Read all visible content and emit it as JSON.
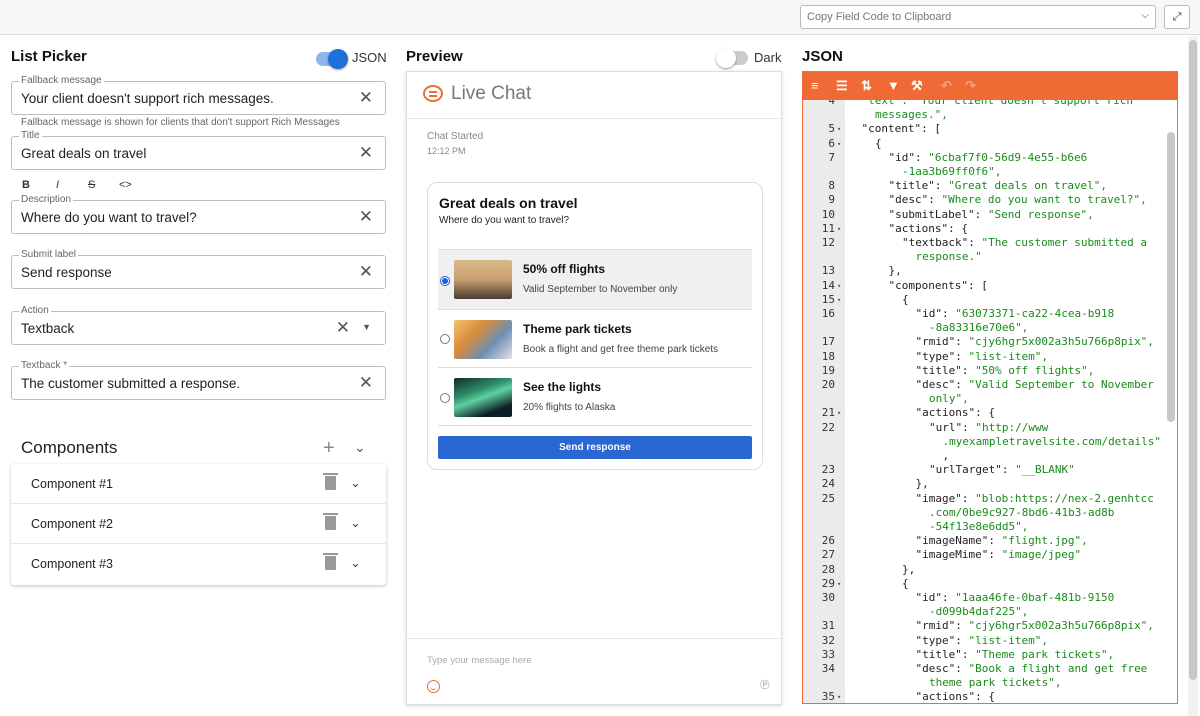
{
  "topbar": {
    "copy_select": "Copy Field Code to Clipboard",
    "expand_icon": "collapse-arrows-icon"
  },
  "left": {
    "title": "List Picker",
    "json_toggle_label": "JSON",
    "json_toggle_on": true,
    "fields": {
      "fallback": {
        "label": "Fallback message",
        "value": "Your client doesn't support rich messages.",
        "helper": "Fallback message is shown for clients that don't support Rich Messages"
      },
      "title": {
        "label": "Title",
        "value": "Great deals on travel"
      },
      "description": {
        "label": "Description",
        "value": "Where do you want to travel?"
      },
      "submit": {
        "label": "Submit label",
        "value": "Send response"
      },
      "action": {
        "label": "Action",
        "value": "Textback"
      },
      "textback": {
        "label": "Textback *",
        "value": "The customer submitted a response."
      }
    },
    "format_buttons": [
      "B",
      "I",
      "S",
      "<>"
    ],
    "components": {
      "title": "Components",
      "items": [
        "Component #1",
        "Component #2",
        "Component #3"
      ]
    }
  },
  "preview": {
    "title": "Preview",
    "dark_label": "Dark",
    "dark_on": false,
    "header": "Live Chat",
    "chat_started": "Chat Started",
    "time": "12:12 PM",
    "message": {
      "title": "Great deals on travel",
      "desc": "Where do you want to travel?",
      "options": [
        {
          "title": "50% off flights",
          "desc": "Valid September to November only",
          "selected": true
        },
        {
          "title": "Theme park tickets",
          "desc": "Book a flight and get free theme park tickets",
          "selected": false
        },
        {
          "title": "See the lights",
          "desc": "20% flights to Alaska",
          "selected": false
        }
      ],
      "button": "Send response"
    },
    "input_placeholder": "Type your message here"
  },
  "json": {
    "title": "JSON",
    "toolbar_icons": [
      "format-icon",
      "compact-icon",
      "sort-icon",
      "filter-icon",
      "repair-icon",
      "undo-icon",
      "redo-icon"
    ],
    "lines": [
      {
        "n": "4",
        "f": "",
        "i": 1,
        "t": [
          [
            "s",
            "\"text\": \"Your client doesn't support rich"
          ]
        ]
      },
      {
        "n": "",
        "f": "",
        "i": 2,
        "t": [
          [
            "s",
            "messages.\","
          ]
        ]
      },
      {
        "n": "5",
        "f": "▾",
        "i": 1,
        "t": [
          [
            "k",
            "\"content\""
          ],
          [
            "p",
            ": ["
          ]
        ]
      },
      {
        "n": "6",
        "f": "▾",
        "i": 2,
        "t": [
          [
            "p",
            "{"
          ]
        ]
      },
      {
        "n": "7",
        "f": "",
        "i": 3,
        "t": [
          [
            "k",
            "\"id\""
          ],
          [
            "p",
            ": "
          ],
          [
            "s",
            "\"6cbaf7f0-56d9-4e55-b6e6"
          ]
        ]
      },
      {
        "n": "",
        "f": "",
        "i": 4,
        "t": [
          [
            "s",
            "-1aa3b69ff0f6\","
          ]
        ]
      },
      {
        "n": "8",
        "f": "",
        "i": 3,
        "t": [
          [
            "k",
            "\"title\""
          ],
          [
            "p",
            ": "
          ],
          [
            "s",
            "\"Great deals on travel\","
          ]
        ]
      },
      {
        "n": "9",
        "f": "",
        "i": 3,
        "t": [
          [
            "k",
            "\"desc\""
          ],
          [
            "p",
            ": "
          ],
          [
            "s",
            "\"Where do you want to travel?\","
          ]
        ]
      },
      {
        "n": "10",
        "f": "",
        "i": 3,
        "t": [
          [
            "k",
            "\"submitLabel\""
          ],
          [
            "p",
            ": "
          ],
          [
            "s",
            "\"Send response\","
          ]
        ]
      },
      {
        "n": "11",
        "f": "▾",
        "i": 3,
        "t": [
          [
            "k",
            "\"actions\""
          ],
          [
            "p",
            ": {"
          ]
        ]
      },
      {
        "n": "12",
        "f": "",
        "i": 4,
        "t": [
          [
            "k",
            "\"textback\""
          ],
          [
            "p",
            ": "
          ],
          [
            "s",
            "\"The customer submitted a"
          ]
        ]
      },
      {
        "n": "",
        "f": "",
        "i": 5,
        "t": [
          [
            "s",
            "response.\""
          ]
        ]
      },
      {
        "n": "13",
        "f": "",
        "i": 3,
        "t": [
          [
            "p",
            "},"
          ]
        ]
      },
      {
        "n": "14",
        "f": "▾",
        "i": 3,
        "t": [
          [
            "k",
            "\"components\""
          ],
          [
            "p",
            ": ["
          ]
        ]
      },
      {
        "n": "15",
        "f": "▾",
        "i": 4,
        "t": [
          [
            "p",
            "{"
          ]
        ]
      },
      {
        "n": "16",
        "f": "",
        "i": 5,
        "t": [
          [
            "k",
            "\"id\""
          ],
          [
            "p",
            ": "
          ],
          [
            "s",
            "\"63073371-ca22-4cea-b918"
          ]
        ]
      },
      {
        "n": "",
        "f": "",
        "i": 6,
        "t": [
          [
            "s",
            "-8a83316e70e6\","
          ]
        ]
      },
      {
        "n": "17",
        "f": "",
        "i": 5,
        "t": [
          [
            "k",
            "\"rmid\""
          ],
          [
            "p",
            ": "
          ],
          [
            "s",
            "\"cjy6hgr5x002a3h5u766p8pix\","
          ]
        ]
      },
      {
        "n": "18",
        "f": "",
        "i": 5,
        "t": [
          [
            "k",
            "\"type\""
          ],
          [
            "p",
            ": "
          ],
          [
            "s",
            "\"list-item\","
          ]
        ]
      },
      {
        "n": "19",
        "f": "",
        "i": 5,
        "t": [
          [
            "k",
            "\"title\""
          ],
          [
            "p",
            ": "
          ],
          [
            "s",
            "\"50% off flights\","
          ]
        ]
      },
      {
        "n": "20",
        "f": "",
        "i": 5,
        "t": [
          [
            "k",
            "\"desc\""
          ],
          [
            "p",
            ": "
          ],
          [
            "s",
            "\"Valid September to November"
          ]
        ]
      },
      {
        "n": "",
        "f": "",
        "i": 6,
        "t": [
          [
            "s",
            "only\","
          ]
        ]
      },
      {
        "n": "21",
        "f": "▾",
        "i": 5,
        "t": [
          [
            "k",
            "\"actions\""
          ],
          [
            "p",
            ": {"
          ]
        ]
      },
      {
        "n": "22",
        "f": "",
        "i": 6,
        "t": [
          [
            "k",
            "\"url\""
          ],
          [
            "p",
            ": "
          ],
          [
            "s",
            "\"http://www"
          ]
        ]
      },
      {
        "n": "",
        "f": "",
        "i": 7,
        "t": [
          [
            "s",
            ".myexampletravelsite.com/details\""
          ]
        ]
      },
      {
        "n": "",
        "f": "",
        "i": 7,
        "t": [
          [
            "p",
            ","
          ]
        ]
      },
      {
        "n": "23",
        "f": "",
        "i": 6,
        "t": [
          [
            "k",
            "\"urlTarget\""
          ],
          [
            "p",
            ": "
          ],
          [
            "s",
            "\"__BLANK\""
          ]
        ]
      },
      {
        "n": "24",
        "f": "",
        "i": 5,
        "t": [
          [
            "p",
            "},"
          ]
        ]
      },
      {
        "n": "25",
        "f": "",
        "i": 5,
        "t": [
          [
            "k",
            "\"image\""
          ],
          [
            "p",
            ": "
          ],
          [
            "s",
            "\"blob:https://nex-2.genhtcc"
          ]
        ]
      },
      {
        "n": "",
        "f": "",
        "i": 6,
        "t": [
          [
            "s",
            ".com/0be9c927-8bd6-41b3-ad8b"
          ]
        ]
      },
      {
        "n": "",
        "f": "",
        "i": 6,
        "t": [
          [
            "s",
            "-54f13e8e6dd5\","
          ]
        ]
      },
      {
        "n": "26",
        "f": "",
        "i": 5,
        "t": [
          [
            "k",
            "\"imageName\""
          ],
          [
            "p",
            ": "
          ],
          [
            "s",
            "\"flight.jpg\","
          ]
        ]
      },
      {
        "n": "27",
        "f": "",
        "i": 5,
        "t": [
          [
            "k",
            "\"imageMime\""
          ],
          [
            "p",
            ": "
          ],
          [
            "s",
            "\"image/jpeg\""
          ]
        ]
      },
      {
        "n": "28",
        "f": "",
        "i": 4,
        "t": [
          [
            "p",
            "},"
          ]
        ]
      },
      {
        "n": "29",
        "f": "▾",
        "i": 4,
        "t": [
          [
            "p",
            "{"
          ]
        ]
      },
      {
        "n": "30",
        "f": "",
        "i": 5,
        "t": [
          [
            "k",
            "\"id\""
          ],
          [
            "p",
            ": "
          ],
          [
            "s",
            "\"1aaa46fe-0baf-481b-9150"
          ]
        ]
      },
      {
        "n": "",
        "f": "",
        "i": 6,
        "t": [
          [
            "s",
            "-d099b4daf225\","
          ]
        ]
      },
      {
        "n": "31",
        "f": "",
        "i": 5,
        "t": [
          [
            "k",
            "\"rmid\""
          ],
          [
            "p",
            ": "
          ],
          [
            "s",
            "\"cjy6hgr5x002a3h5u766p8pix\","
          ]
        ]
      },
      {
        "n": "32",
        "f": "",
        "i": 5,
        "t": [
          [
            "k",
            "\"type\""
          ],
          [
            "p",
            ": "
          ],
          [
            "s",
            "\"list-item\","
          ]
        ]
      },
      {
        "n": "33",
        "f": "",
        "i": 5,
        "t": [
          [
            "k",
            "\"title\""
          ],
          [
            "p",
            ": "
          ],
          [
            "s",
            "\"Theme park tickets\","
          ]
        ]
      },
      {
        "n": "34",
        "f": "",
        "i": 5,
        "t": [
          [
            "k",
            "\"desc\""
          ],
          [
            "p",
            ": "
          ],
          [
            "s",
            "\"Book a flight and get free"
          ]
        ]
      },
      {
        "n": "",
        "f": "",
        "i": 6,
        "t": [
          [
            "s",
            "theme park tickets\","
          ]
        ]
      },
      {
        "n": "35",
        "f": "▾",
        "i": 5,
        "t": [
          [
            "k",
            "\"actions\""
          ],
          [
            "p",
            ": {"
          ]
        ]
      }
    ]
  },
  "colors": {
    "accent": "#f06a35",
    "primary_blue": "#2b67d1",
    "json_string": "#1a8a1a"
  }
}
